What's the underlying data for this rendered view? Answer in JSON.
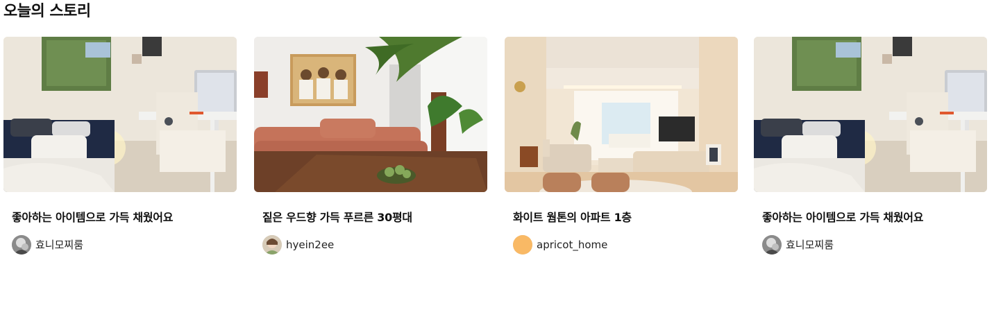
{
  "section": {
    "title": "오늘의 스토리"
  },
  "stories": [
    {
      "title": "좋아하는 아이템으로 가득 채웠어요",
      "author": "효니모찌룸",
      "image": "bedroom-workspace-photo",
      "avatar": "user-photo-avatar"
    },
    {
      "title": "짙은 우드향 가득 푸르른 30평대",
      "author": "hyein2ee",
      "image": "living-room-sofa-photo",
      "avatar": "user-photo-avatar"
    },
    {
      "title": "화이트 웜톤의 아파트 1층",
      "author": "apricot_home",
      "image": "white-living-room-photo",
      "avatar": "default-orange-avatar",
      "avatar_color": "#F9B965"
    },
    {
      "title": "좋아하는 아이템으로 가득 채웠어요",
      "author": "효니모찌룸",
      "image": "bedroom-workspace-photo",
      "avatar": "user-photo-avatar"
    }
  ]
}
